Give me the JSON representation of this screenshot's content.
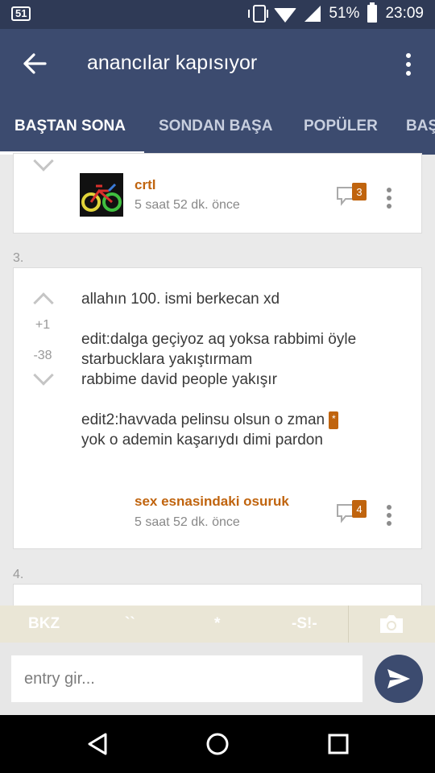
{
  "status_bar": {
    "notification": "51",
    "battery_percent": "51%",
    "time": "23:09"
  },
  "app_bar": {
    "title": "anancılar kapısıyor"
  },
  "tabs": [
    {
      "label": "BAŞTAN SONA",
      "active": true
    },
    {
      "label": "SONDAN BAŞA",
      "active": false
    },
    {
      "label": "POPÜLER",
      "active": false
    },
    {
      "label": "BAŞ",
      "active": false
    }
  ],
  "entries": [
    {
      "author": "crtl",
      "time": "5 saat 52 dk. önce",
      "comment_count": "3"
    },
    {
      "index": "3.",
      "upvotes": "+1",
      "downvotes": "-38",
      "lines": [
        "allahın 100. ismi berkecan xd",
        "",
        "edit:dalga geçiyoz aq yoksa rabbimi öyle",
        "starbucklara yakıştırmam",
        "rabbime david people yakışır",
        "",
        "edit2:havvada pelinsu olsun o zman",
        "yok o ademin kaşarıydı dimi pardon"
      ],
      "star_glyph": "*",
      "author": "sex esnasindaki osuruk",
      "time": "5 saat 52 dk. önce",
      "comment_count": "4"
    },
    {
      "index": "4."
    }
  ],
  "toolbar": {
    "bkz": "BKZ",
    "backtick": "``",
    "asterisk": "*",
    "spoiler": "-S!-"
  },
  "input": {
    "placeholder": "entry gir..."
  },
  "colors": {
    "primary": "#3c4b6f",
    "status_bar": "#2f3a56",
    "accent": "#c0640e"
  }
}
